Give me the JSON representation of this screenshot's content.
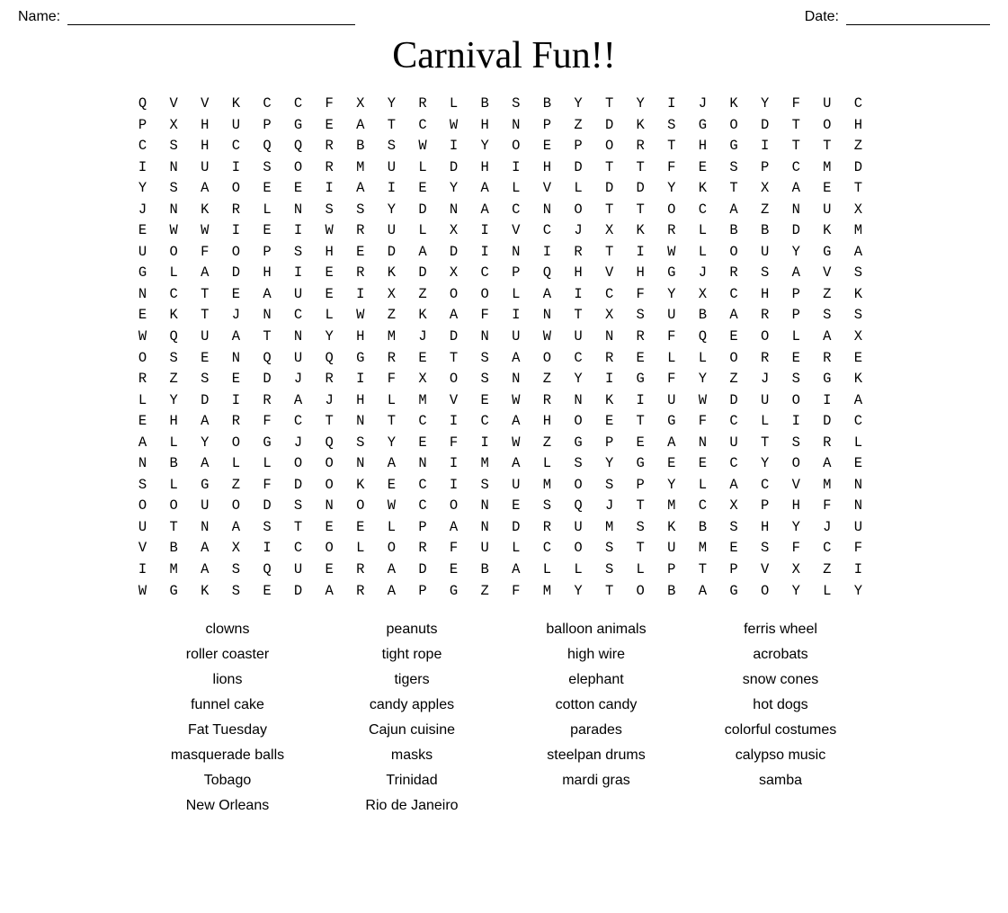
{
  "header": {
    "name_label": "Name:",
    "date_label": "Date:"
  },
  "title": "Carnival Fun!!",
  "grid_rows": [
    "Q V V K C C F X Y R L B S B Y T Y I J K Y F U C",
    "P X H U P G E A T C W H N P Z D K S G O D T O H",
    "C S H C Q Q R B S W I Y O E P O R T H G I T T Z",
    "I N U I S O R M U L D H I H D T T F E S P C M D",
    "Y S A O E E I A I E Y A L V L D D Y K T X A E T",
    "J N K R L N S S Y D N A C N O T T O C A Z N U X",
    "E W W I E I W R U L X I V C J X K R L B B D K M",
    "U O F O P S H E D A D I N I R T I W L O U Y G A",
    "G L A D H I E R K D X C P Q H V H G J R S A V S",
    "N C T E A U E I X Z O O L A I C F Y X C H P Z K",
    "E K T J N C L W Z K A F I N T X S U B A R P S S",
    "W Q U A T N Y H M J D N U W U N R F Q E O L A X",
    "O S E N Q U Q G R E T S A O C R E L L O R E R E",
    "R Z S E D J R I F X O S N Z Y I G F Y Z J S G K",
    "L Y D I R A J H L M V E W R N K I U W D U O I A",
    "E H A R F C T N T C I C A H O E T G F C L I D C",
    "A L Y O G J Q S Y E F I W Z G P E A N U T S R L",
    "N B A L L O O N A N I M A L S Y G E E C Y O A E",
    "S L G Z F D O K E C I S U M O S P Y L A C V M N",
    "O O U O D S N O W C O N E S Q J T M C X P H F N",
    "U T N A S T E E L P A N D R U M S K B S H Y J U",
    "V B A X I C O L O R F U L C O S T U M E S F C F",
    "I M A S Q U E R A D E B A L L S L P T P V X Z I",
    "W G K S E D A R A P G Z F M Y T O B A G O Y L Y"
  ],
  "word_list": [
    [
      "clowns",
      "peanuts",
      "balloon animals",
      "ferris wheel"
    ],
    [
      "roller coaster",
      "tight rope",
      "high wire",
      "acrobats"
    ],
    [
      "lions",
      "tigers",
      "elephant",
      "snow cones"
    ],
    [
      "funnel cake",
      "candy apples",
      "cotton candy",
      "hot dogs"
    ],
    [
      "Fat Tuesday",
      "Cajun cuisine",
      "parades",
      "colorful costumes"
    ],
    [
      "masquerade balls",
      "masks",
      "steelpan drums",
      "calypso music"
    ],
    [
      "Tobago",
      "Trinidad",
      "mardi gras",
      "samba"
    ],
    [
      "New Orleans",
      "Rio de\nJaneiro",
      "",
      ""
    ]
  ]
}
